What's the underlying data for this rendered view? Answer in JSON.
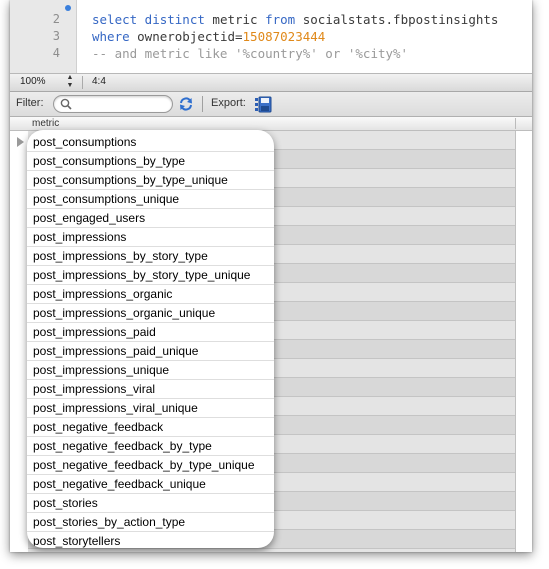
{
  "editor": {
    "lines": [
      {
        "number": "2",
        "parts": [
          {
            "text": "select distinct ",
            "style": "kw"
          },
          {
            "text": "metric ",
            "style": "tx"
          },
          {
            "text": "from ",
            "style": "kw"
          },
          {
            "text": "socialstats.fbpostinsights",
            "style": "tx"
          }
        ]
      },
      {
        "number": "3",
        "parts": [
          {
            "text": "where ",
            "style": "kw"
          },
          {
            "text": "ownerobjectid=",
            "style": "tx"
          },
          {
            "text": "15087023444",
            "style": "num"
          }
        ]
      },
      {
        "number": "4",
        "parts": [
          {
            "text": "-- and metric like '%country%' or '%city%'",
            "style": "cm"
          }
        ]
      }
    ]
  },
  "status": {
    "zoom": "100%",
    "position": "4:4"
  },
  "toolbar": {
    "filter_label": "Filter:",
    "search_placeholder": "",
    "export_label": "Export:"
  },
  "result": {
    "column_header": "metric",
    "rows": [
      "post_consumptions",
      "post_consumptions_by_type",
      "post_consumptions_by_type_unique",
      "post_consumptions_unique",
      "post_engaged_users",
      "post_impressions",
      "post_impressions_by_story_type",
      "post_impressions_by_story_type_unique",
      "post_impressions_organic",
      "post_impressions_organic_unique",
      "post_impressions_paid",
      "post_impressions_paid_unique",
      "post_impressions_unique",
      "post_impressions_viral",
      "post_impressions_viral_unique",
      "post_negative_feedback",
      "post_negative_feedback_by_type",
      "post_negative_feedback_by_type_unique",
      "post_negative_feedback_unique",
      "post_stories",
      "post_stories_by_action_type",
      "post_storytellers"
    ]
  },
  "colors": {
    "keyword": "#3567c4",
    "number": "#e0891a",
    "comment": "#9a9a9a",
    "breakpoint": "#3a7fdc"
  }
}
